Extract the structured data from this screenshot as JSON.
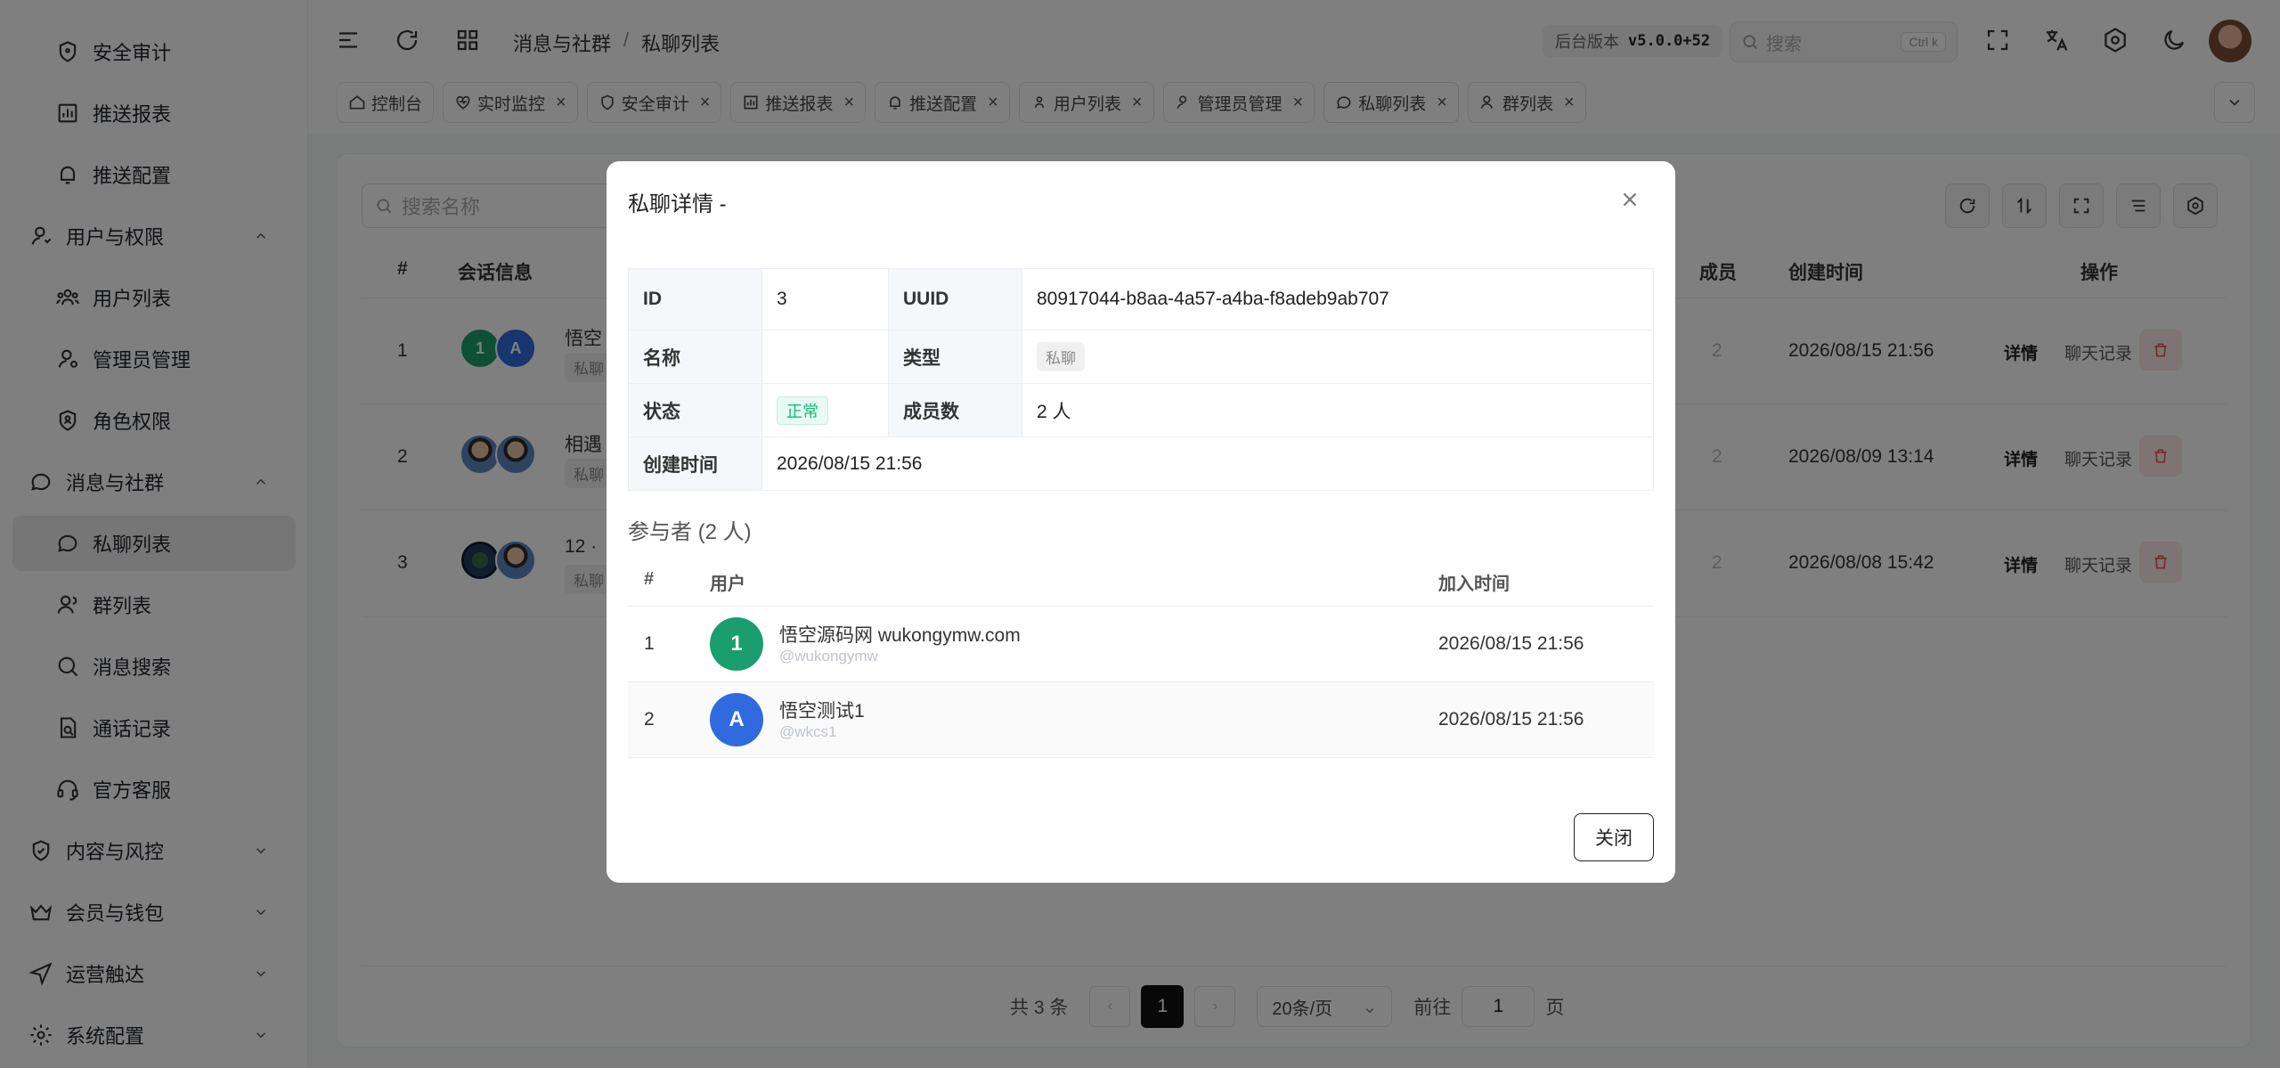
{
  "sidebar": {
    "items": [
      {
        "label": "安全审计",
        "icon": "shield-icon"
      },
      {
        "label": "推送报表",
        "icon": "bar-chart-icon"
      },
      {
        "label": "推送配置",
        "icon": "bell-icon"
      },
      {
        "label": "用户与权限",
        "icon": "user-icon"
      },
      {
        "label": "用户列表",
        "icon": "users-icon"
      },
      {
        "label": "管理员管理",
        "icon": "admin-icon"
      },
      {
        "label": "角色权限",
        "icon": "shield-user-icon"
      },
      {
        "label": "消息与社群",
        "icon": "chat-icon"
      },
      {
        "label": "私聊列表",
        "icon": "chat-bubble-icon"
      },
      {
        "label": "群列表",
        "icon": "group-icon"
      },
      {
        "label": "消息搜索",
        "icon": "search-icon"
      },
      {
        "label": "通话记录",
        "icon": "call-log-icon"
      },
      {
        "label": "官方客服",
        "icon": "headset-icon"
      },
      {
        "label": "内容与风控",
        "icon": "shield-check-icon"
      },
      {
        "label": "会员与钱包",
        "icon": "crown-icon"
      },
      {
        "label": "运营触达",
        "icon": "send-icon"
      },
      {
        "label": "系统配置",
        "icon": "gear-icon"
      }
    ]
  },
  "header": {
    "breadcrumb": [
      "消息与社群",
      "/",
      "私聊列表"
    ],
    "version_label": "后台版本",
    "version_value": "v5.0.0+52",
    "search_placeholder": "搜索",
    "search_shortcut": "Ctrl k"
  },
  "tabs": [
    {
      "label": "控制台",
      "icon": "home-icon",
      "closable": false
    },
    {
      "label": "实时监控",
      "icon": "heartbeat-icon",
      "closable": true
    },
    {
      "label": "安全审计",
      "icon": "shield-icon",
      "closable": true
    },
    {
      "label": "推送报表",
      "icon": "bar-chart-icon",
      "closable": true
    },
    {
      "label": "推送配置",
      "icon": "bell-icon",
      "closable": true
    },
    {
      "label": "用户列表",
      "icon": "users-icon",
      "closable": true
    },
    {
      "label": "管理员管理",
      "icon": "admin-icon",
      "closable": true
    },
    {
      "label": "私聊列表",
      "icon": "chat-bubble-icon",
      "closable": true
    },
    {
      "label": "群列表",
      "icon": "group-icon",
      "closable": true
    }
  ],
  "list": {
    "search_placeholder": "搜索名称",
    "columns": [
      "#",
      "会话信息",
      "成员",
      "创建时间",
      "操作"
    ],
    "rows": [
      {
        "index": "1",
        "name": "悟空",
        "tag": "私聊",
        "members": "2",
        "created": "2026/08/15 21:56"
      },
      {
        "index": "2",
        "name": "相遇",
        "tag": "私聊",
        "members": "2",
        "created": "2026/08/09 13:14"
      },
      {
        "index": "3",
        "name": "12 · ",
        "tag": "私聊",
        "members": "2",
        "created": "2026/08/08 15:42"
      }
    ],
    "action_detail": "详情",
    "action_chat": "聊天记录",
    "pager": {
      "total": "共 3 条",
      "current_page": "1",
      "page_size": "20条/页",
      "goto_prefix": "前往",
      "goto_value": "1",
      "goto_suffix": "页"
    }
  },
  "modal": {
    "title": "私聊详情 -",
    "details": {
      "id_label": "ID",
      "id_value": "3",
      "uuid_label": "UUID",
      "uuid_value": "80917044-b8aa-4a57-a4ba-f8adeb9ab707",
      "name_label": "名称",
      "name_value": "",
      "type_label": "类型",
      "type_value": "私聊",
      "status_label": "状态",
      "status_value": "正常",
      "members_label": "成员数",
      "members_value": "2 人",
      "created_label": "创建时间",
      "created_value": "2026/08/15 21:56"
    },
    "participants_title": "参与者 (2 人)",
    "participants_columns": [
      "#",
      "用户",
      "加入时间"
    ],
    "participants": [
      {
        "index": "1",
        "avatar_letter": "1",
        "avatar_color": "#1a9e6f",
        "name": "悟空源码网 wukongymw.com",
        "handle": "@wukongymw",
        "joined": "2026/08/15 21:56"
      },
      {
        "index": "2",
        "avatar_letter": "A",
        "avatar_color": "#2f6bdf",
        "name": "悟空测试1",
        "handle": "@wkcs1",
        "joined": "2026/08/15 21:56"
      }
    ],
    "close_button": "关闭"
  }
}
